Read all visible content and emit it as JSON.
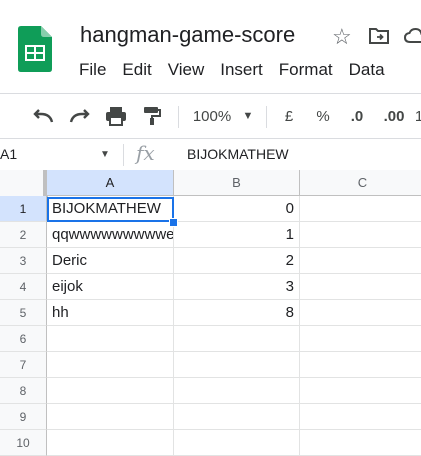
{
  "document": {
    "title": "hangman-game-score"
  },
  "menu": [
    "File",
    "Edit",
    "View",
    "Insert",
    "Format",
    "Data"
  ],
  "toolbar": {
    "zoom": "100%",
    "currency": "£",
    "percent": "%",
    "dec_decrease": ".0",
    "dec_increase": ".00",
    "more": "1"
  },
  "formula_bar": {
    "cell_ref": "A1",
    "fx": "fx",
    "value": "BIJOKMATHEW"
  },
  "columns": [
    "A",
    "B",
    "C"
  ],
  "rows": [
    {
      "num": "1",
      "a": "BIJOKMATHEW",
      "b": "0"
    },
    {
      "num": "2",
      "a": "qqwwwwwwwwwe",
      "b": "1"
    },
    {
      "num": "3",
      "a": "Deric",
      "b": "2"
    },
    {
      "num": "4",
      "a": "eijok",
      "b": "3"
    },
    {
      "num": "5",
      "a": "hh",
      "b": "8"
    },
    {
      "num": "6",
      "a": "",
      "b": ""
    },
    {
      "num": "7",
      "a": "",
      "b": ""
    },
    {
      "num": "8",
      "a": "",
      "b": ""
    },
    {
      "num": "9",
      "a": "",
      "b": ""
    },
    {
      "num": "10",
      "a": "",
      "b": ""
    }
  ],
  "colors": {
    "sheets_green": "#0f9d58",
    "selection_blue": "#1a73e8",
    "header_selected": "#d3e3fd"
  }
}
